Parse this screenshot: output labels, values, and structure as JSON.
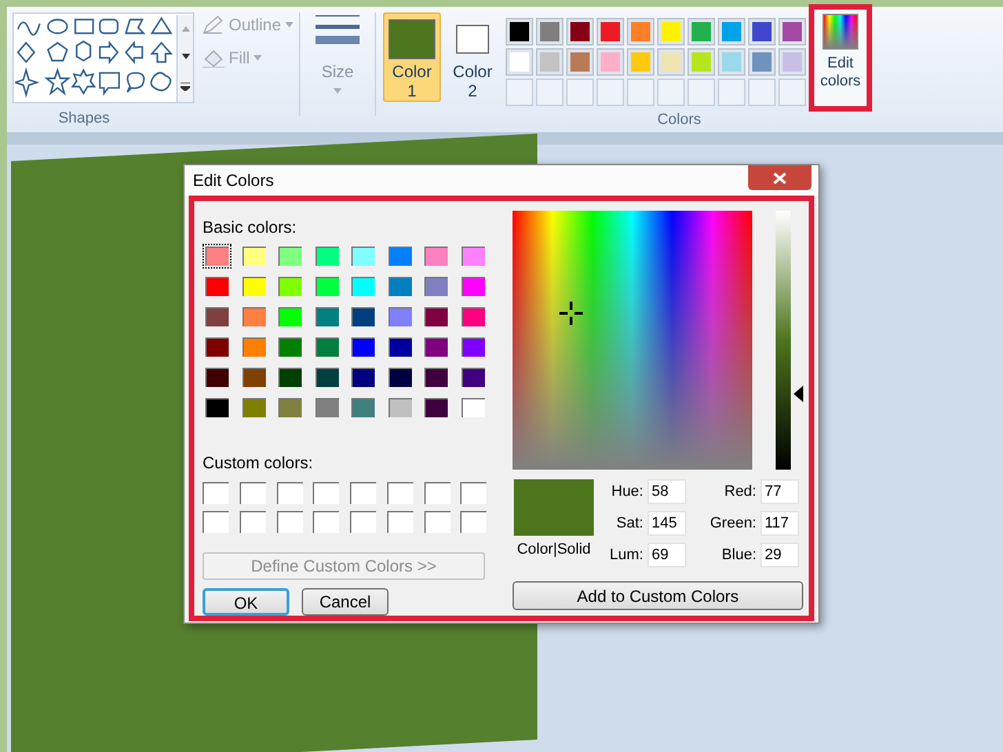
{
  "ribbon": {
    "shapes": {
      "outline": "Outline",
      "fill": "Fill",
      "label": "Shapes"
    },
    "size": {
      "label": "Size"
    },
    "color_1": {
      "label": "Color",
      "number": "1",
      "selected": true,
      "color": "#4d751d"
    },
    "color_2": {
      "label": "Color",
      "number": "2",
      "selected": false,
      "color": "#ffffff"
    },
    "palette": [
      {
        "color": "#000000"
      },
      {
        "color": "#7f7f7f"
      },
      {
        "color": "#880015"
      },
      {
        "color": "#ed1c24"
      },
      {
        "color": "#ff7f27"
      },
      {
        "color": "#fff200"
      },
      {
        "color": "#22b14c"
      },
      {
        "color": "#00a2e8"
      },
      {
        "color": "#3f48cc"
      },
      {
        "color": "#a349a4"
      },
      {
        "color": "#ffffff"
      },
      {
        "color": "#c3c3c3"
      },
      {
        "color": "#b97a57"
      },
      {
        "color": "#ffaec9"
      },
      {
        "color": "#ffc90e"
      },
      {
        "color": "#efe4b0"
      },
      {
        "color": "#b5e61d"
      },
      {
        "color": "#99d9ea"
      },
      {
        "color": "#7092be"
      },
      {
        "color": "#c8bfe7"
      }
    ],
    "colors_label": "Colors",
    "edit_colors": {
      "label": "Edit colors",
      "highlighted": true
    }
  },
  "dialog": {
    "title": "Edit Colors",
    "highlighted": true,
    "basic_colors_label": "Basic colors:",
    "basic_colors": [
      {
        "color": "#ff8080",
        "selected": true
      },
      {
        "color": "#ffff80",
        "selected": false
      },
      {
        "color": "#80ff80",
        "selected": false
      },
      {
        "color": "#00ff80",
        "selected": false
      },
      {
        "color": "#80ffff",
        "selected": false
      },
      {
        "color": "#0080ff",
        "selected": false
      },
      {
        "color": "#ff80c0",
        "selected": false
      },
      {
        "color": "#ff80ff",
        "selected": false
      },
      {
        "color": "#ff0000",
        "selected": false
      },
      {
        "color": "#ffff00",
        "selected": false
      },
      {
        "color": "#80ff00",
        "selected": false
      },
      {
        "color": "#00ff40",
        "selected": false
      },
      {
        "color": "#00ffff",
        "selected": false
      },
      {
        "color": "#0080c0",
        "selected": false
      },
      {
        "color": "#8080c0",
        "selected": false
      },
      {
        "color": "#ff00ff",
        "selected": false
      },
      {
        "color": "#804040",
        "selected": false
      },
      {
        "color": "#ff8040",
        "selected": false
      },
      {
        "color": "#00ff00",
        "selected": false
      },
      {
        "color": "#008080",
        "selected": false
      },
      {
        "color": "#004080",
        "selected": false
      },
      {
        "color": "#8080ff",
        "selected": false
      },
      {
        "color": "#800040",
        "selected": false
      },
      {
        "color": "#ff0080",
        "selected": false
      },
      {
        "color": "#800000",
        "selected": false
      },
      {
        "color": "#ff8000",
        "selected": false
      },
      {
        "color": "#008000",
        "selected": false
      },
      {
        "color": "#008040",
        "selected": false
      },
      {
        "color": "#0000ff",
        "selected": false
      },
      {
        "color": "#0000a0",
        "selected": false
      },
      {
        "color": "#800080",
        "selected": false
      },
      {
        "color": "#8000ff",
        "selected": false
      },
      {
        "color": "#400000",
        "selected": false
      },
      {
        "color": "#804000",
        "selected": false
      },
      {
        "color": "#004000",
        "selected": false
      },
      {
        "color": "#004040",
        "selected": false
      },
      {
        "color": "#000080",
        "selected": false
      },
      {
        "color": "#000040",
        "selected": false
      },
      {
        "color": "#400040",
        "selected": false
      },
      {
        "color": "#400080",
        "selected": false
      },
      {
        "color": "#000000",
        "selected": false
      },
      {
        "color": "#808000",
        "selected": false
      },
      {
        "color": "#808040",
        "selected": false
      },
      {
        "color": "#808080",
        "selected": false
      },
      {
        "color": "#408080",
        "selected": false
      },
      {
        "color": "#c0c0c0",
        "selected": false
      },
      {
        "color": "#400040",
        "selected": false
      },
      {
        "color": "#ffffff",
        "selected": false
      }
    ],
    "custom_colors_label": "Custom colors:",
    "define_button": {
      "label": "Define Custom Colors >>",
      "disabled": true
    },
    "ok_button": {
      "label": "OK",
      "default": true
    },
    "cancel_button": {
      "label": "Cancel",
      "default": false
    },
    "luminance_slider": {
      "level": 0.29
    },
    "preview": {
      "color": "#4d751d",
      "label": "Color|Solid"
    },
    "fields": [
      {
        "label": "Hue:",
        "value": "58"
      },
      {
        "label": "Red:",
        "value": "77"
      },
      {
        "label": "Sat:",
        "value": "145"
      },
      {
        "label": "Green:",
        "value": "117"
      },
      {
        "label": "Lum:",
        "value": "69"
      },
      {
        "label": "Blue:",
        "value": "29"
      }
    ],
    "add_button": {
      "label": "Add to Custom Colors"
    }
  }
}
